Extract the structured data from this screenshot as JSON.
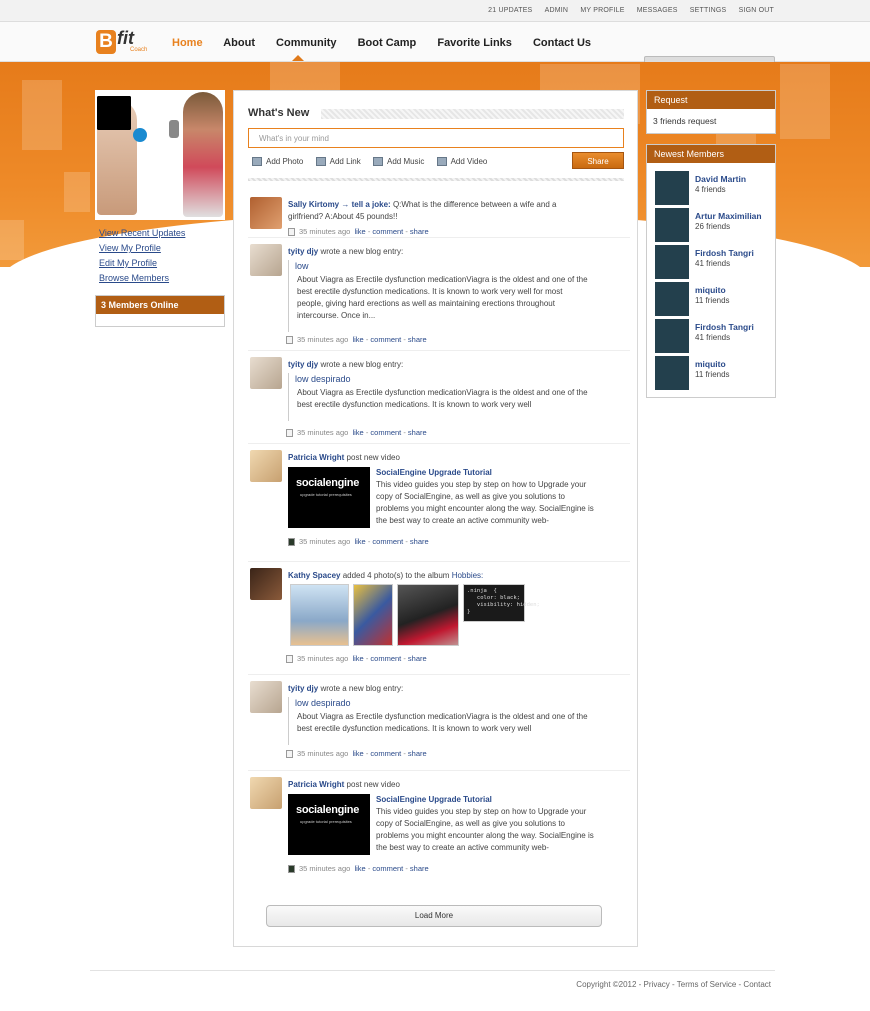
{
  "topbar": {
    "links": [
      "21 UPDATES",
      "ADMIN",
      "MY PROFILE",
      "MESSAGES",
      "SETTINGS",
      "SIGN OUT"
    ]
  },
  "logo": {
    "letter": "B",
    "word": "fit",
    "sub": "Coach"
  },
  "nav": {
    "items": [
      "Home",
      "About",
      "Community",
      "Boot Camp",
      "Favorite Links",
      "Contact Us"
    ],
    "active": "Home"
  },
  "left": {
    "links": [
      "View Recent Updates",
      "View My Profile",
      "Edit My Profile",
      "Browse Members"
    ],
    "online_title": "3 Members Online"
  },
  "composer": {
    "title": "What's New",
    "placeholder": "What's in your mind",
    "actions": [
      "Add Photo",
      "Add Link",
      "Add Music",
      "Add Video"
    ],
    "share_label": "Share"
  },
  "feed": {
    "joke": {
      "name": "Sally Kirtomy → tell a joke:",
      "text": "Q:What is the difference between a wife and a girlfriend? A:About 45 pounds!!",
      "time": "35 minutes ago"
    },
    "blog1": {
      "name": "tyity djy",
      "action": "wrote a new blog entry:",
      "title": "low",
      "text": "About Viagra as Erectile dysfunction medicationViagra is the oldest and one of the best erectile dysfunction medications. It is known to work very well for most people, giving hard erections as well as maintaining erections throughout intercourse. Once in...",
      "time": "35 minutes ago"
    },
    "blog2": {
      "name": "tyity djy",
      "action": "wrote a new blog entry:",
      "title": "low despirado",
      "text": "About Viagra as Erectile dysfunction medicationViagra is the oldest and one of the best erectile dysfunction medications. It is known to work very well",
      "time": "35 minutes ago"
    },
    "video1": {
      "name": "Patricia Wright",
      "action": "post new video",
      "title": "SocialEngine Upgrade Tutorial",
      "text": "This video guides you step by step on how to Upgrade your copy of SocialEngine, as well as give you solutions to problems you might encounter along the way. SocialEngine is the best way to create an active community web-",
      "thumb_text": "socialengine",
      "thumb_sub": "upgrade tutorial prerequisites",
      "time": "35 minutes ago"
    },
    "album": {
      "name": "Kathy Spacey",
      "action": "added 4 photo(s) to the album",
      "album": "Hobbies:",
      "code": ".ninja  {\n   color: black;\n   visibility: hidden;\n}",
      "time": "35 minutes ago"
    },
    "blog3": {
      "name": "tyity djy",
      "action": "wrote a new blog entry:",
      "title": "low despirado",
      "text": "About Viagra as Erectile dysfunction medicationViagra is the oldest and one of the best erectile dysfunction medications. It is known to work very well",
      "time": "35 minutes ago"
    },
    "video2": {
      "name": "Patricia Wright",
      "action": "post new video",
      "title": "SocialEngine Upgrade Tutorial",
      "text": "This video guides you step by step on how to Upgrade your copy of SocialEngine, as well as give you solutions to problems you might encounter along the way. SocialEngine is the best way to create an active community web-",
      "thumb_text": "socialengine",
      "thumb_sub": "upgrade tutorial prerequisites",
      "time": "35 minutes ago"
    },
    "like": "like",
    "comment": "comment",
    "share": "share",
    "load_more": "Load More"
  },
  "right": {
    "request_title": "Request",
    "request_text": "3 friends request",
    "members_title": "Newest Members",
    "members": [
      {
        "name": "David Martin",
        "friends": "4 friends"
      },
      {
        "name": "Artur Maximilian",
        "friends": "26 friends"
      },
      {
        "name": "Firdosh Tangri",
        "friends": "41 friends"
      },
      {
        "name": "miquito",
        "friends": "11 friends"
      },
      {
        "name": "Firdosh Tangri",
        "friends": "41 friends"
      },
      {
        "name": "miquito",
        "friends": "11 friends"
      }
    ]
  },
  "footer": {
    "text": "Copyright ©2012  -  Privacy  -  Terms of Service  -  Contact"
  },
  "colors": {
    "accent": "#e8811e",
    "header": "#b15e14",
    "link": "#2a4a8a"
  }
}
